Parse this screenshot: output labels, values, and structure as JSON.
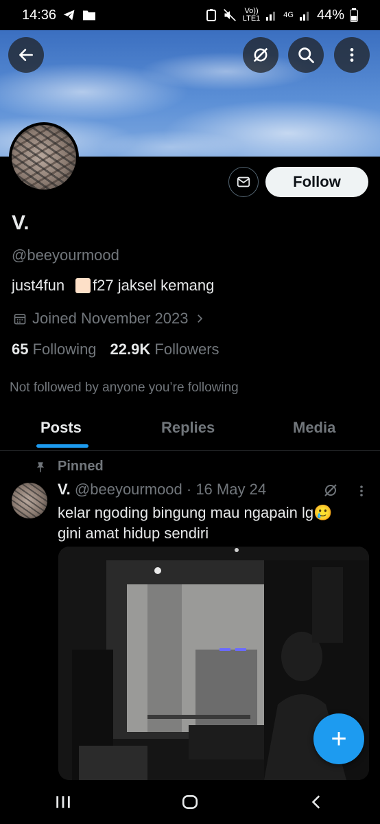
{
  "status_bar": {
    "time": "14:36",
    "volte_top": "Vo))",
    "volte_bottom": "LTE1",
    "network_type": "4G",
    "battery": "44%"
  },
  "profile": {
    "name": "V.",
    "handle": "@beeyourmood",
    "bio_part1": "just4fun",
    "bio_part2": "f27 jaksel kemang",
    "joined": "Joined November 2023",
    "following_count": "65",
    "following_label": "Following",
    "followers_count": "22.9K",
    "followers_label": "Followers",
    "not_followed": "Not followed by anyone you’re following",
    "follow_label": "Follow"
  },
  "tabs": [
    {
      "label": "Posts",
      "active": true
    },
    {
      "label": "Replies",
      "active": false
    },
    {
      "label": "Media",
      "active": false
    }
  ],
  "post": {
    "pinned_label": "Pinned",
    "author": "V.",
    "handle_date": "@beeyourmood · 16 May 24",
    "text_line1": "kelar ngoding bingung mau ngapain lg",
    "emoji": "🥲",
    "text_line2": "gini amat hidup sendiri"
  },
  "fab_label": "+",
  "colors": {
    "accent": "#1d9bf0",
    "text_primary": "#e7e9ea",
    "text_secondary": "#71767b",
    "background": "#000000"
  }
}
